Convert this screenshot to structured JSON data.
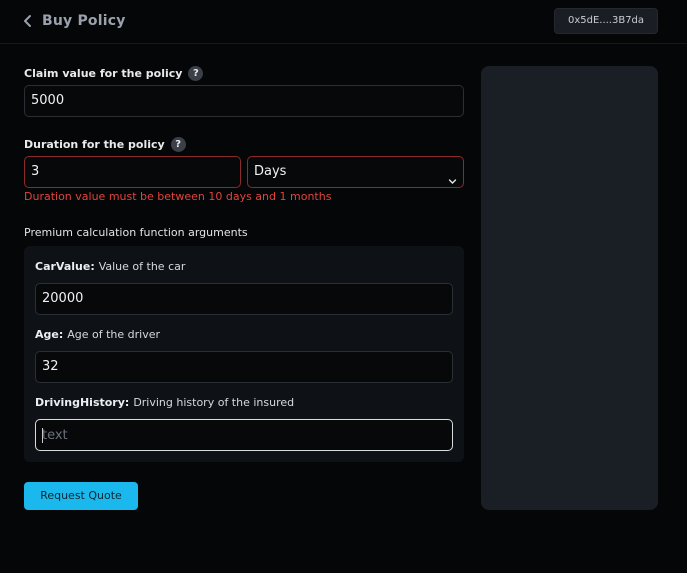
{
  "header": {
    "title": "Buy Policy",
    "wallet": "0x5dE....3B7da"
  },
  "claim": {
    "label": "Claim value for the policy",
    "help": "?",
    "value": "5000"
  },
  "duration": {
    "label": "Duration for the policy",
    "help": "?",
    "value": "3",
    "unit": "Days",
    "error": "Duration value must be between 10 days and 1 months"
  },
  "premium": {
    "title": "Premium calculation function arguments",
    "args": [
      {
        "name": "CarValue:",
        "desc": "Value of the car",
        "value": "20000"
      },
      {
        "name": "Age:",
        "desc": "Age of the driver",
        "value": "32"
      },
      {
        "name": "DrivingHistory:",
        "desc": "Driving history of the insured",
        "value": "",
        "placeholder": "text"
      }
    ]
  },
  "actions": {
    "request_quote": "Request Quote"
  },
  "colors": {
    "accent": "#1ab8ec",
    "error": "#e0443e",
    "panel": "#1a1e25"
  }
}
